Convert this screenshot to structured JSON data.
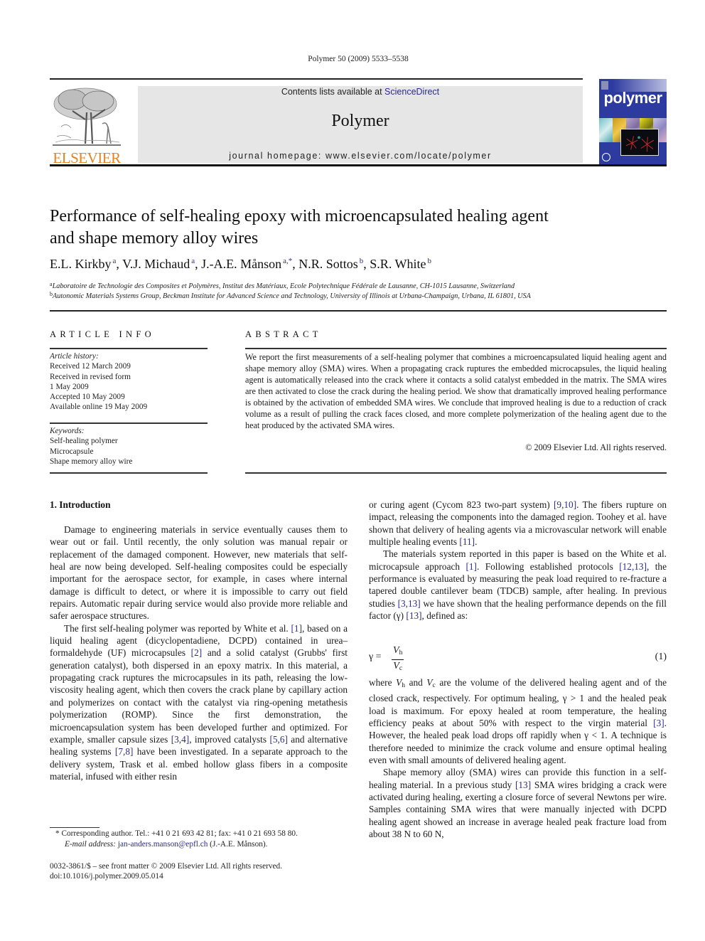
{
  "header": {
    "citation": "Polymer 50 (2009) 5533–5538",
    "publisher_logo_text": "ELSEVIER",
    "contents_prefix": "Contents lists available at ",
    "contents_link": "ScienceDirect",
    "journal_name": "Polymer",
    "homepage": "journal homepage: www.elsevier.com/locate/polymer",
    "cover_title": "polymer",
    "colors": {
      "elsevier_orange": "#e8821e",
      "journal_box_gray": "#e6e6e6",
      "cover_blue": "#2d3aa0",
      "link_blue": "#2b2b8c"
    }
  },
  "article": {
    "title_line1": "Performance of self-healing epoxy with microencapsulated healing agent",
    "title_line2": "and shape memory alloy wires",
    "authors": [
      {
        "name": "E.L. Kirkby",
        "sup": "a",
        "sep": ", "
      },
      {
        "name": "V.J. Michaud",
        "sup": "a",
        "sep": ", "
      },
      {
        "name": "J.-A.E. Månson",
        "sup": "a,*",
        "sep": ", "
      },
      {
        "name": "N.R. Sottos",
        "sup": "b",
        "sep": ", "
      },
      {
        "name": "S.R. White",
        "sup": "b",
        "sep": ""
      }
    ],
    "affiliations": [
      {
        "mark": "a",
        "text": "Laboratoire de Technologie des Composites et Polymères, Institut des Matériaux, Ecole Polytechnique Fédérale de Lausanne, CH-1015 Lausanne, Switzerland"
      },
      {
        "mark": "b",
        "text": "Autonomic Materials Systems Group, Beckman Institute for Advanced Science and Technology, University of Illinois at Urbana-Champaign, Urbana, IL 61801, USA"
      }
    ]
  },
  "article_info": {
    "heading": "ARTICLE INFO",
    "history_label": "Article history:",
    "history": [
      "Received 12 March 2009",
      "Received in revised form",
      "1 May 2009",
      "Accepted 10 May 2009",
      "Available online 19 May 2009"
    ],
    "keywords_label": "Keywords:",
    "keywords": [
      "Self-healing polymer",
      "Microcapsule",
      "Shape memory alloy wire"
    ]
  },
  "abstract": {
    "heading": "ABSTRACT",
    "text": "We report the first measurements of a self-healing polymer that combines a microencapsulated liquid healing agent and shape memory alloy (SMA) wires. When a propagating crack ruptures the embedded microcapsules, the liquid healing agent is automatically released into the crack where it contacts a solid catalyst embedded in the matrix. The SMA wires are then activated to close the crack during the healing period. We show that dramatically improved healing performance is obtained by the activation of embedded SMA wires. We conclude that improved healing is due to a reduction of crack volume as a result of pulling the crack faces closed, and more complete polymerization of the healing agent due to the heat produced by the activated SMA wires.",
    "copyright": "© 2009 Elsevier Ltd. All rights reserved."
  },
  "introduction": {
    "heading": "1.  Introduction",
    "p1": "Damage to engineering materials in service eventually causes them to wear out or fail. Until recently, the only solution was manual repair or replacement of the damaged component. However, new materials that self-heal are now being developed. Self-healing composites could be especially important for the aerospace sector, for example, in cases where internal damage is difficult to detect, or where it is impossible to carry out field repairs. Automatic repair during service would also provide more reliable and safer aerospace structures.",
    "p2": {
      "t1": "The first self-healing polymer was reported by White et al. ",
      "r1": "[1]",
      "t2": ", based on a liquid healing agent (dicyclopentadiene, DCPD) contained in urea–formaldehyde (UF) microcapsules ",
      "r2": "[2]",
      "t3": " and a solid catalyst (Grubbs' first generation catalyst), both dispersed in an epoxy matrix. In this material, a propagating crack ruptures the microcapsules in its path, releasing the low-viscosity healing agent, which then covers the crack plane by capillary action and polymerizes on contact with the catalyst via ring-opening metathesis polymerization (ROMP). Since the first demonstration, the microencapsulation system has been developed further and optimized. For example, smaller capsule sizes ",
      "r3": "[3,4]",
      "t4": ", improved catalysts ",
      "r4": "[5,6]",
      "t5": " and alternative healing systems ",
      "r5": "[7,8]",
      "t6": " have been investigated. In a separate approach to the delivery system, Trask et al. embed hollow glass fibers in a composite material, infused with either resin"
    },
    "right_p1": {
      "t1": "or curing agent (Cycom 823 two-part system) ",
      "r1": "[9,10]",
      "t2": ". The fibers rupture on impact, releasing the components into the damaged region. Toohey et al. have shown that delivery of healing agents via a microvascular network will enable multiple healing events ",
      "r2": "[11]",
      "t3": "."
    },
    "right_p2": {
      "t1": "The materials system reported in this paper is based on the White et al. microcapsule approach ",
      "r1": "[1]",
      "t2": ". Following established protocols ",
      "r2": "[12,13]",
      "t3": ", the performance is evaluated by measuring the peak load required to re-fracture a tapered double cantilever beam (TDCB) sample, after healing. In previous studies ",
      "r3": "[3,13]",
      "t4": " we have shown that the healing performance depends on the fill factor (γ) ",
      "r4": "[13]",
      "t5": ", defined as:"
    },
    "equation": {
      "lhs": "γ  =",
      "num_var": "V",
      "num_sub": "h",
      "den_var": "V",
      "den_sub": "c",
      "number": "(1)"
    },
    "right_p3": {
      "t1": "where ",
      "v1": "V",
      "s1": "h",
      "t2": " and ",
      "v2": "V",
      "s2": "c",
      "t3": " are the volume of the delivered healing agent and of the closed crack, respectively. For optimum healing, γ > 1 and the healed peak load is maximum. For epoxy healed at room temperature, the healing efficiency peaks at about 50% with respect to the virgin material ",
      "r1": "[3]",
      "t4": ". However, the healed peak load drops off rapidly when γ < 1. A technique is therefore needed to minimize the crack volume and ensure optimal healing even with small amounts of delivered healing agent."
    },
    "right_p4": {
      "t1": "Shape memory alloy (SMA) wires can provide this function in a self-healing material. In a previous study ",
      "r1": "[13]",
      "t2": " SMA wires bridging a crack were activated during healing, exerting a closure force of several Newtons per wire. Samples containing SMA wires that were manually injected with DCPD healing agent showed an increase in average healed peak fracture load from about 38 N to 60 N,"
    }
  },
  "footnotes": {
    "corresponding": "*  Corresponding author. Tel.: +41 0 21 693 42 81; fax: +41 0 21 693 58 80.",
    "email_label": "E-mail address: ",
    "email": "jan-anders.manson@epfl.ch",
    "email_suffix": " (J.-A.E. Månson).",
    "front_matter": "0032-3861/$ – see front matter © 2009 Elsevier Ltd. All rights reserved.",
    "doi": "doi:10.1016/j.polymer.2009.05.014"
  }
}
